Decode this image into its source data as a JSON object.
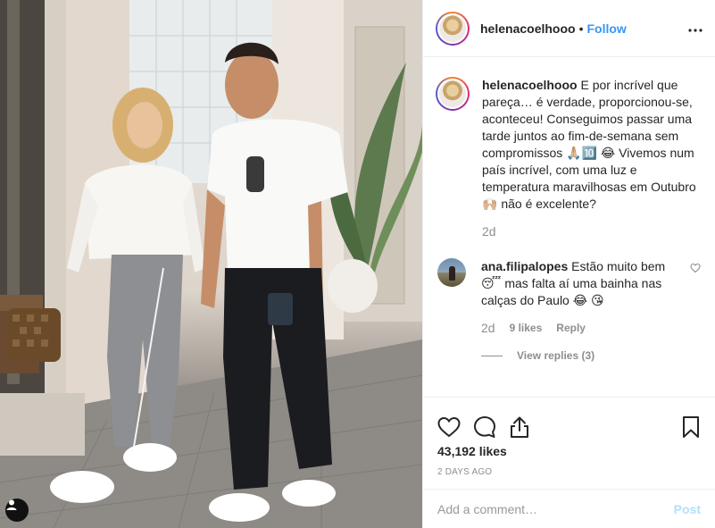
{
  "post": {
    "username": "helenacoelhooo",
    "separator": "•",
    "follow_label": "Follow",
    "caption": "E por incrível que pareça… é verdade, proporcionou-se, aconteceu! Conseguimos passar uma tarde juntos ao fim-de-semana sem compromissos 🙏🏼🔟 😂 Vivemos num país incrível, com uma luz e temperatura maravilhosas em Outubro 🙌🏼 não é excelente?",
    "caption_time": "2d",
    "likes": "43,192 likes",
    "date": "2 DAYS AGO"
  },
  "comments": [
    {
      "username": "ana.filipalopes",
      "text": "Estão muito bem 😴 mas falta aí uma bainha nas calças do Paulo 😂 😘",
      "time": "2d",
      "likes": "9 likes",
      "reply_label": "Reply",
      "view_replies": "View replies (3)"
    }
  ],
  "add_comment": {
    "placeholder": "Add a comment…",
    "post_label": "Post"
  },
  "icons": {
    "more": "more-horizontal-icon",
    "heart": "heart-icon",
    "comment": "comment-icon",
    "share": "share-icon",
    "save": "bookmark-icon",
    "tagged": "user-tag-icon"
  }
}
